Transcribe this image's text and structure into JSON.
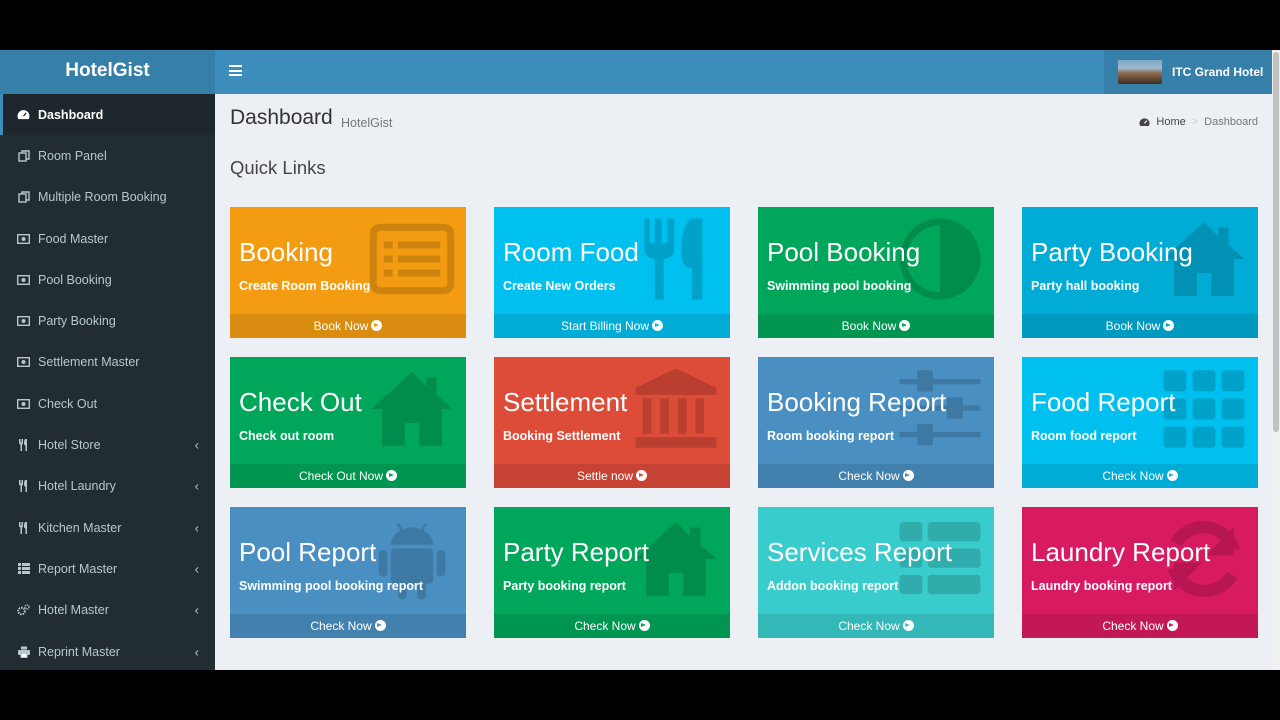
{
  "app": {
    "logo": "HotelGist"
  },
  "header": {
    "hotel_name": "ITC Grand Hotel"
  },
  "sidebar": {
    "items": [
      {
        "label": "Dashboard",
        "icon": "dashboard-icon",
        "active": true,
        "submenu": false
      },
      {
        "label": "Room Panel",
        "icon": "copy-icon",
        "active": false,
        "submenu": false
      },
      {
        "label": "Multiple Room Booking",
        "icon": "copy-icon",
        "active": false,
        "submenu": false
      },
      {
        "label": "Food Master",
        "icon": "money-icon",
        "active": false,
        "submenu": false
      },
      {
        "label": "Pool Booking",
        "icon": "money-icon",
        "active": false,
        "submenu": false
      },
      {
        "label": "Party Booking",
        "icon": "money-icon",
        "active": false,
        "submenu": false
      },
      {
        "label": "Settlement Master",
        "icon": "money-icon",
        "active": false,
        "submenu": false
      },
      {
        "label": "Check Out",
        "icon": "money-icon",
        "active": false,
        "submenu": false
      },
      {
        "label": "Hotel Store",
        "icon": "cutlery-icon",
        "active": false,
        "submenu": true
      },
      {
        "label": "Hotel Laundry",
        "icon": "cutlery-icon",
        "active": false,
        "submenu": true
      },
      {
        "label": "Kitchen Master",
        "icon": "cutlery-icon",
        "active": false,
        "submenu": true
      },
      {
        "label": "Report Master",
        "icon": "list-icon",
        "active": false,
        "submenu": true
      },
      {
        "label": "Hotel Master",
        "icon": "cogs-icon",
        "active": false,
        "submenu": true
      },
      {
        "label": "Reprint Master",
        "icon": "print-icon",
        "active": false,
        "submenu": true
      }
    ]
  },
  "content": {
    "title": "Dashboard",
    "subtitle": "HotelGist",
    "breadcrumb": {
      "home": "Home",
      "current": "Dashboard"
    },
    "section_title": "Quick Links"
  },
  "tiles": [
    {
      "title": "Booking",
      "desc": "Create Room Booking",
      "link": "Book Now",
      "color": "#f39c12",
      "icon": "list-alt-icon"
    },
    {
      "title": "Room Food",
      "desc": "Create New Orders",
      "link": "Start Billing Now",
      "color": "#00c0ef",
      "icon": "cutlery-icon"
    },
    {
      "title": "Pool Booking",
      "desc": "Swimming pool booking",
      "link": "Book Now",
      "color": "#00a65a",
      "icon": "adjust-icon"
    },
    {
      "title": "Party Booking",
      "desc": "Party hall booking",
      "link": "Book Now",
      "color": "#00acd6",
      "icon": "home-icon"
    },
    {
      "title": "Check Out",
      "desc": "Check out room",
      "link": "Check Out Now",
      "color": "#00a65a",
      "icon": "home-icon"
    },
    {
      "title": "Settlement",
      "desc": "Booking Settlement",
      "link": "Settle now",
      "color": "#dd4b39",
      "icon": "bank-icon"
    },
    {
      "title": "Booking Report",
      "desc": "Room booking report",
      "link": "Check Now",
      "color": "#4a8fc1",
      "icon": "sliders-icon"
    },
    {
      "title": "Food Report",
      "desc": "Room food report",
      "link": "Check Now",
      "color": "#00c0ef",
      "icon": "th-icon"
    },
    {
      "title": "Pool Report",
      "desc": "Swimming pool booking report",
      "link": "Check Now",
      "color": "#4a8fc1",
      "icon": "android-icon"
    },
    {
      "title": "Party Report",
      "desc": "Party booking report",
      "link": "Check Now",
      "color": "#00a65a",
      "icon": "home-icon"
    },
    {
      "title": "Services Report",
      "desc": "Addon booking report",
      "link": "Check Now",
      "color": "#39cccc",
      "icon": "th-list-icon"
    },
    {
      "title": "Laundry Report",
      "desc": "Laundry booking report",
      "link": "Check Now",
      "color": "#d81b60",
      "icon": "refresh-icon"
    }
  ]
}
